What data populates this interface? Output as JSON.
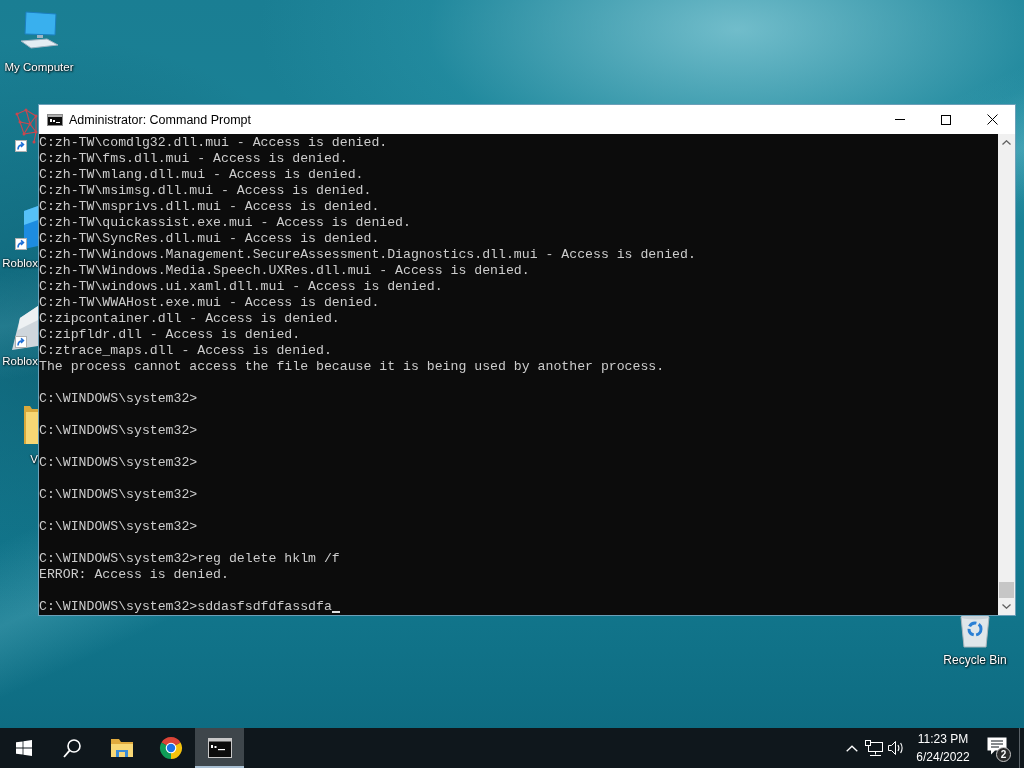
{
  "desktop_icons": [
    {
      "kind": "computer",
      "label": "My Computer",
      "shortcut": false
    },
    {
      "kind": "network",
      "shortcut": true
    },
    {
      "kind": "tile",
      "label": "Roblox",
      "shortcut": true
    },
    {
      "kind": "light_tile",
      "label": "Roblox",
      "shortcut": true
    },
    {
      "kind": "folder",
      "label": "V",
      "shortcut": false
    }
  ],
  "recycle_bin": {
    "label": "Recycle Bin"
  },
  "window": {
    "title": "Administrator: Command Prompt",
    "console": {
      "lines": [
        {
          "kind": "text",
          "text": "C:zh-TW\\comdlg32.dll.mui - Access is denied."
        },
        {
          "kind": "text",
          "text": "C:zh-TW\\fms.dll.mui - Access is denied."
        },
        {
          "kind": "text",
          "text": "C:zh-TW\\mlang.dll.mui - Access is denied."
        },
        {
          "kind": "text",
          "text": "C:zh-TW\\msimsg.dll.mui - Access is denied."
        },
        {
          "kind": "text",
          "text": "C:zh-TW\\msprivs.dll.mui - Access is denied."
        },
        {
          "kind": "text",
          "text": "C:zh-TW\\quickassist.exe.mui - Access is denied."
        },
        {
          "kind": "text",
          "text": "C:zh-TW\\SyncRes.dll.mui - Access is denied."
        },
        {
          "kind": "text",
          "text": "C:zh-TW\\Windows.Management.SecureAssessment.Diagnostics.dll.mui - Access is denied."
        },
        {
          "kind": "text",
          "text": "C:zh-TW\\Windows.Media.Speech.UXRes.dll.mui - Access is denied."
        },
        {
          "kind": "text",
          "text": "C:zh-TW\\windows.ui.xaml.dll.mui - Access is denied."
        },
        {
          "kind": "text",
          "text": "C:zh-TW\\WWAHost.exe.mui - Access is denied."
        },
        {
          "kind": "text",
          "text": "C:zipcontainer.dll - Access is denied."
        },
        {
          "kind": "text",
          "text": "C:zipfldr.dll - Access is denied."
        },
        {
          "kind": "text",
          "text": "C:ztrace_maps.dll - Access is denied."
        },
        {
          "kind": "text",
          "text": "The process cannot access the file because it is being used by another process."
        },
        {
          "kind": "blank"
        },
        {
          "kind": "text",
          "text": "C:\\WINDOWS\\system32>"
        },
        {
          "kind": "blank"
        },
        {
          "kind": "text",
          "text": "C:\\WINDOWS\\system32>"
        },
        {
          "kind": "blank"
        },
        {
          "kind": "text",
          "text": "C:\\WINDOWS\\system32>"
        },
        {
          "kind": "blank"
        },
        {
          "kind": "text",
          "text": "C:\\WINDOWS\\system32>"
        },
        {
          "kind": "blank"
        },
        {
          "kind": "text",
          "text": "C:\\WINDOWS\\system32>"
        },
        {
          "kind": "blank"
        },
        {
          "kind": "text",
          "text": "C:\\WINDOWS\\system32>reg delete hklm /f"
        },
        {
          "kind": "text",
          "text": "ERROR: Access is denied."
        },
        {
          "kind": "blank"
        },
        {
          "kind": "input",
          "text": "C:\\WINDOWS\\system32>sddasfsdfdfassdfa",
          "cursor": true
        }
      ]
    }
  },
  "taskbar": {
    "buttons": [
      {
        "kind": "start",
        "active": false
      },
      {
        "kind": "search",
        "active": false
      },
      {
        "kind": "folder",
        "active": false
      },
      {
        "kind": "browser",
        "active": false
      },
      {
        "kind": "terminal",
        "active": true
      }
    ],
    "tray": {
      "icons": [
        {
          "kind": "chevron"
        },
        {
          "kind": "network"
        },
        {
          "kind": "volume"
        }
      ],
      "time": "11:23 PM",
      "date": "6/24/2022",
      "notification_count": "2"
    }
  }
}
